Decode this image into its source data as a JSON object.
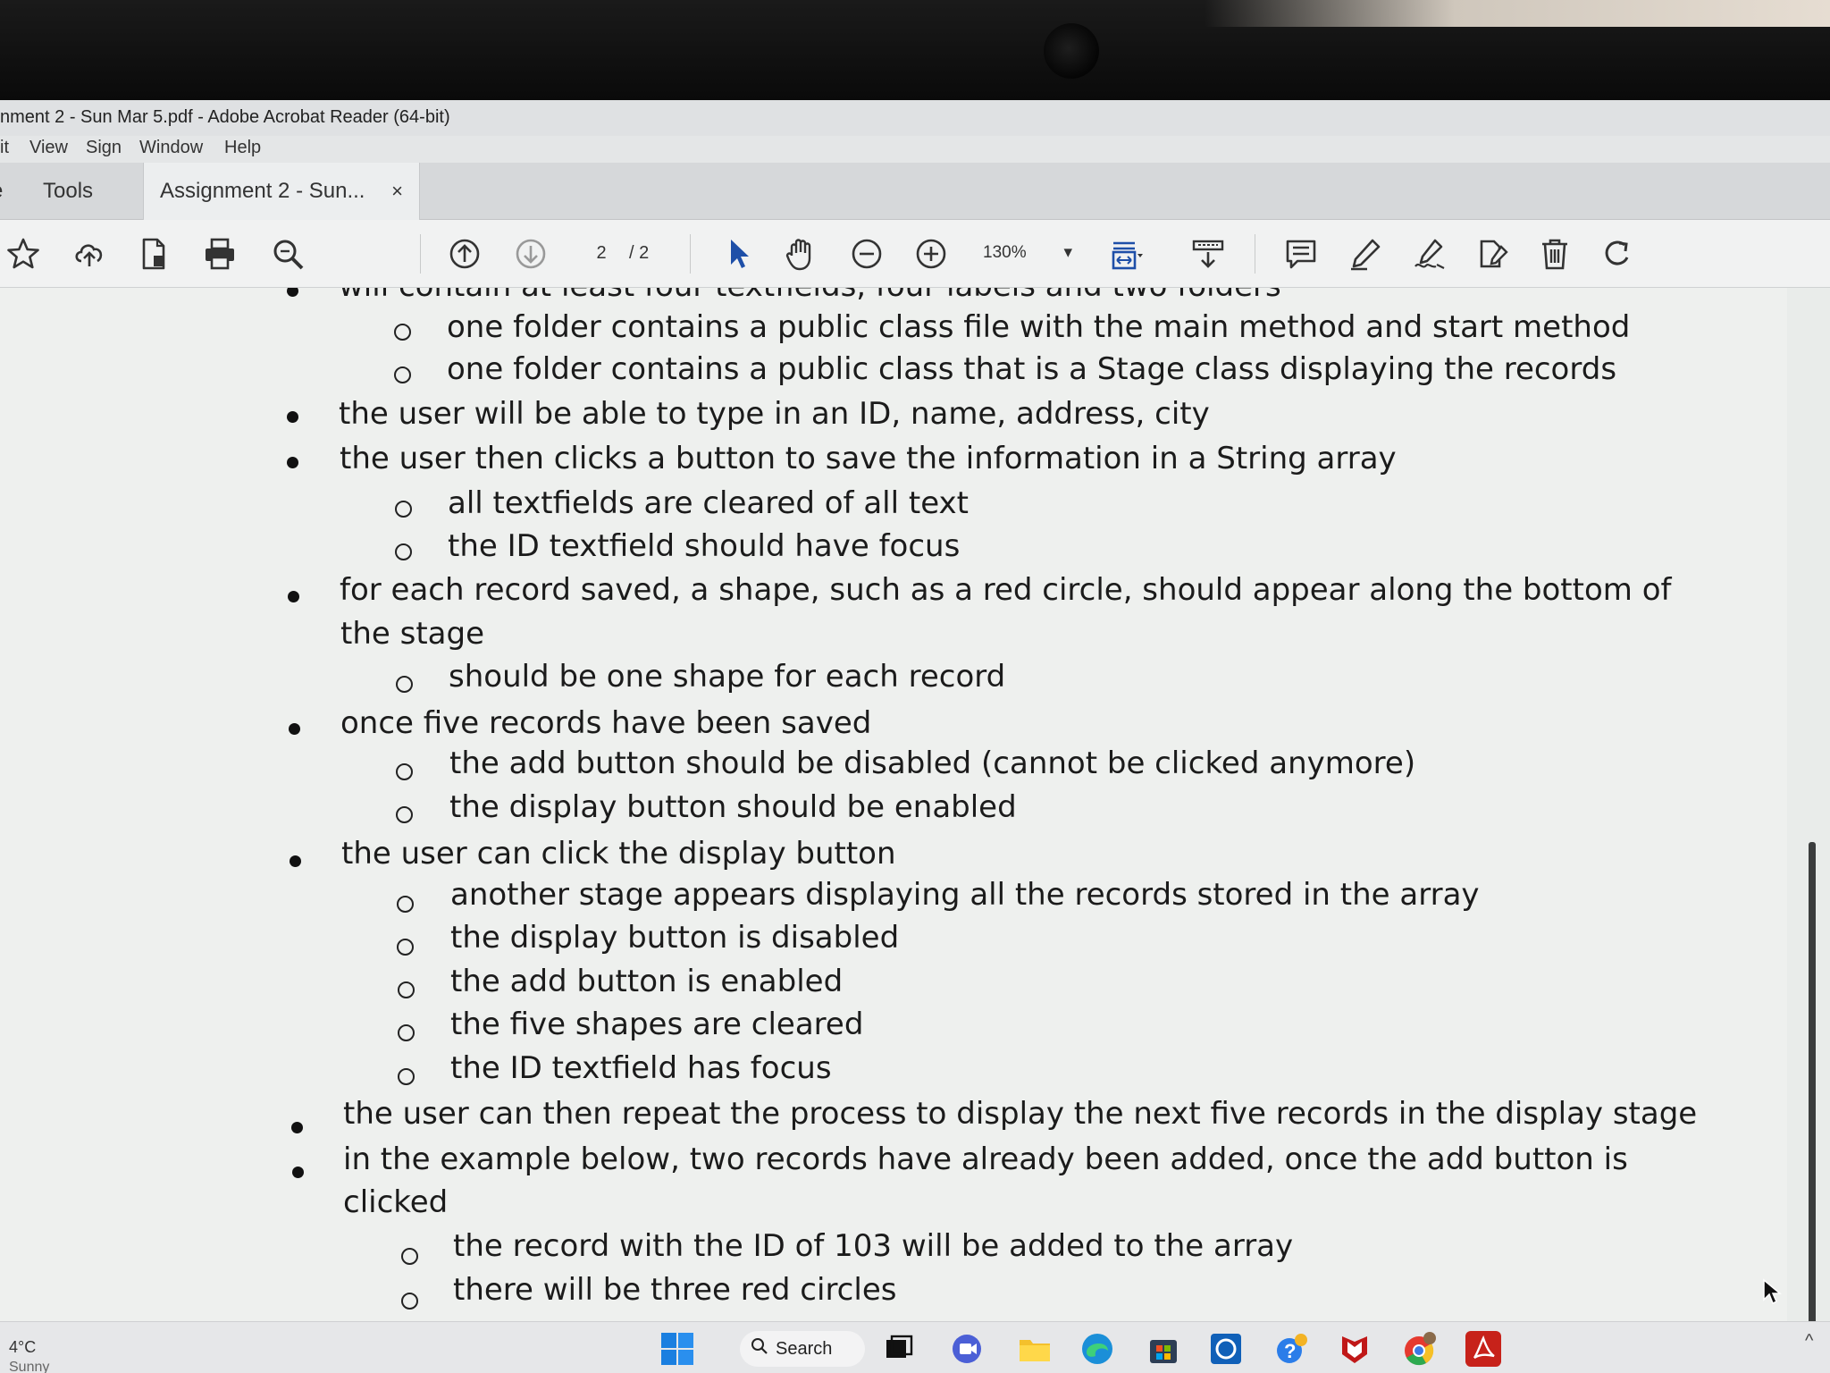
{
  "window": {
    "title": "nment 2 - Sun Mar 5.pdf - Adobe Acrobat Reader (64-bit)"
  },
  "menu": [
    "it",
    "View",
    "Sign",
    "Window",
    "Help"
  ],
  "tabs": {
    "home_fragment": "e",
    "tools": "Tools",
    "document": "Assignment 2 - Sun...",
    "close": "×"
  },
  "toolbar": {
    "current_page": "2",
    "page_total": "/ 2",
    "zoom": "130%",
    "zoom_arrow": "▾"
  },
  "document": {
    "lines": [
      "will contain at least four textfields, four labels and two folders",
      "one folder contains a public class file with the main method and start method",
      "one folder contains a public class that is a Stage class displaying the records",
      "the user will be able to type in an ID, name, address, city",
      "the user then clicks a button to save the information in a String array",
      "all textfields are cleared of all text",
      "the ID textfield should have focus",
      "for each record saved, a shape, such as a red circle, should appear along the bottom of",
      "the stage",
      "should be one shape for each record",
      "once five records have been saved",
      "the add button should be disabled (cannot be clicked anymore)",
      "the display button should be enabled",
      "the user can click the display button",
      "another stage appears displaying all the records stored in the array",
      "the display button is disabled",
      "the add button is enabled",
      "the five shapes are cleared",
      "the ID textfield has focus",
      "the user can then repeat the process to display the next five records in the display stage",
      "in the example below, two records have already been added, once the add button is",
      "clicked",
      "the record with the ID of 103 will be added to the array",
      "there will be three red circles"
    ]
  },
  "taskbar": {
    "temperature": "4°C",
    "weather": "Sunny",
    "search": "Search"
  }
}
